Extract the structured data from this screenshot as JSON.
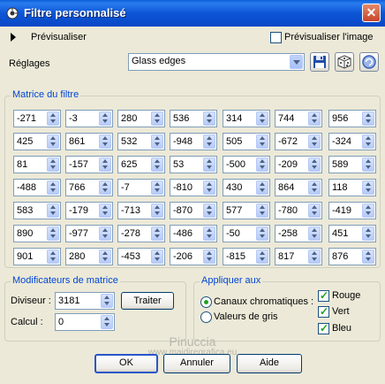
{
  "window": {
    "title": "Filtre personnalisé",
    "close_glyph": "✕"
  },
  "preview": {
    "label": "Prévisualiser",
    "checkbox_label": "Prévisualiser l'image",
    "checked": false
  },
  "presets": {
    "label": "Réglages",
    "value": "Glass edges"
  },
  "matrix": {
    "title": "Matrice du filtre",
    "rows": [
      [
        "-271",
        "-3",
        "280",
        "536",
        "314",
        "744",
        "956"
      ],
      [
        "425",
        "861",
        "532",
        "-948",
        "505",
        "-672",
        "-324"
      ],
      [
        "81",
        "-157",
        "625",
        "53",
        "-500",
        "-209",
        "589"
      ],
      [
        "-488",
        "766",
        "-7",
        "-810",
        "430",
        "864",
        "118"
      ],
      [
        "583",
        "-179",
        "-713",
        "-870",
        "577",
        "-780",
        "-419"
      ],
      [
        "890",
        "-977",
        "-278",
        "-486",
        "-50",
        "-258",
        "451"
      ],
      [
        "901",
        "280",
        "-453",
        "-206",
        "-815",
        "817",
        "876"
      ]
    ]
  },
  "modifiers": {
    "title": "Modificateurs de matrice",
    "divisor_label": "Diviseur :",
    "divisor_value": "3181",
    "bias_label": "Calcul :",
    "bias_value": "0",
    "process_button": "Traiter"
  },
  "apply": {
    "title": "Appliquer aux",
    "color_channels": "Canaux chromatiques :",
    "greyscale": "Valeurs de gris",
    "selected": "color_channels",
    "red": "Rouge",
    "green": "Vert",
    "blue": "Bleu"
  },
  "buttons": {
    "ok": "OK",
    "cancel": "Annuler",
    "help": "Aide"
  },
  "watermark": {
    "line1": "Pinuccia",
    "line2": "www.maidiregrafica.eu"
  },
  "colors": {
    "titlebar": "#0a5fd8",
    "group_title": "#0046d5",
    "dialog_bg": "#ece9d8",
    "check": "#21a121"
  }
}
